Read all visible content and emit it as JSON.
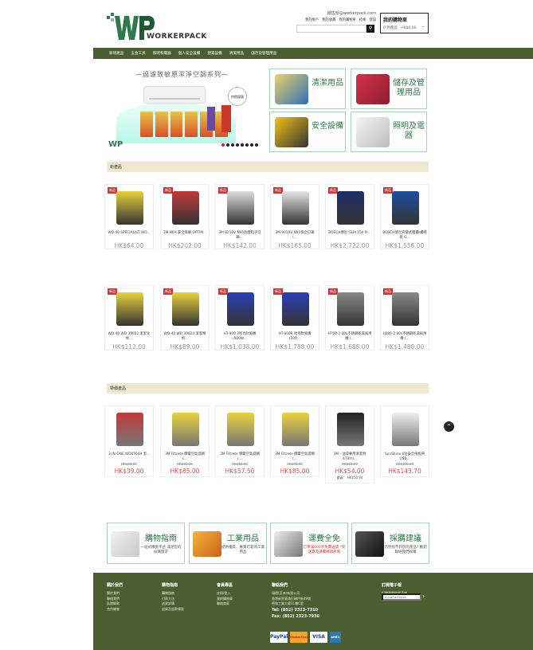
{
  "header": {
    "logo_text": "WORKERPACK",
    "email": "銷售部@workerpack.com",
    "top_links": [
      "我的帳戶",
      "我的收藏",
      "我的購物車",
      "結帳",
      "登錄"
    ],
    "search_placeholder": "",
    "search_icon": "search-icon",
    "cart_title": "我的購物車",
    "cart_value": "0 件產品 - HK$0.00"
  },
  "nav": {
    "items": [
      "新增產品",
      "五金工具",
      "照明和電器",
      "個人安全設備",
      "建築設備",
      "清潔用品",
      "儲存及管理用品"
    ]
  },
  "banner": {
    "title": "—過濾致敏原潔淨空調系列—",
    "tag": "特價優惠"
  },
  "categories": [
    {
      "label": "清潔用品",
      "icon": "cleaning-icon"
    },
    {
      "label": "儲存及管理用品",
      "icon": "storage-icon"
    },
    {
      "label": "安全設備",
      "icon": "safety-icon"
    },
    {
      "label": "照明及電器",
      "icon": "lighting-icon"
    }
  ],
  "sections": {
    "new_title": "新產品",
    "special_title": "特價產品"
  },
  "new_products": [
    {
      "name": "WD-40 SPECIALIST WD...",
      "price": "HK$64.00",
      "badge": "新品"
    },
    {
      "name": "3M H6A 安全耳罩 OPTIM...",
      "price": "HK$202.00",
      "badge": "新品"
    },
    {
      "name": "3M 8210V N95防塵粒子口罩(...",
      "price": "HK$142.00",
      "badge": "新品"
    },
    {
      "name": "3M 9010V N95保全口罩 (...",
      "price": "HK$165.00",
      "badge": "新品"
    },
    {
      "name": "BOSCH博世 GLM 150 Pr...",
      "price": "HK$2,722.00",
      "badge": "新品"
    },
    {
      "name": "BOSCH博世充電式電鑽/螺絲批 G...",
      "price": "HK$1,556.00",
      "badge": "新品"
    },
    {
      "name": "WD-40 WD 39022 潔潔化劑...",
      "price": "HK$112.00",
      "badge": "新品"
    },
    {
      "name": "WD-40 WD 39024 潔潔精劑...",
      "price": "HK$89.00",
      "badge": "新品"
    },
    {
      "name": "HT-900 3馬力吹風機 (900W...",
      "price": "HK$1,038.00",
      "badge": "新品"
    },
    {
      "name": "HT-900R 地毯吹風機 (200...",
      "price": "HK$1,788.00",
      "badge": "新品"
    },
    {
      "name": "HT60-2 60L不銹鋼乾濕兩用機 (...",
      "price": "HK$1,688.00",
      "badge": "新品"
    },
    {
      "name": "LD80-2 80L不銹鋼乾濕兩用機 (...",
      "price": "HK$1,488.00",
      "badge": "新品"
    }
  ],
  "special_products": [
    {
      "name": "3-IN-ONE WD65049 潔...",
      "old": "HK$48.00",
      "price": "HK$39.00"
    },
    {
      "name": "3M Filtrete 靜電空氣濾網 (...",
      "old": "HK$98.00",
      "price": "HK$85.00"
    },
    {
      "name": "3M Filtrete 靜電空氣濾網 (...",
      "old": "HK$68.00",
      "price": "HK$57.50"
    },
    {
      "name": "3M Filtrete 靜電空氣濾網 (...",
      "old": "HK$98.00",
      "price": "HK$85.00"
    },
    {
      "name": "3M - 油漆專用清潔劑 473ml...",
      "old": "HK$60.00",
      "price": "HK$54.00",
      "member": "會員： HK$50.00"
    },
    {
      "name": "SunShine 6位安全拖板帶USB...",
      "old": "HK$155.00",
      "price": "HK$143.70"
    }
  ],
  "services": [
    {
      "title": "購物指南",
      "desc": "一站式購買平台 滿足您的採購需求",
      "icon": "shopping-cart-icon"
    },
    {
      "title": "工業用品",
      "desc": "提供優質、專業可靠的工業用品",
      "icon": "safety-gear-icon"
    },
    {
      "title": "運費全免",
      "desc": "訂單滿400享免費送貨 *受送貨及運費條款所限",
      "icon": "delivery-truck-icon"
    },
    {
      "title": "採購建議",
      "desc": "仍然找不到您的產品? 歡迎聯絡我們採購",
      "icon": "phone-icon"
    }
  ],
  "footer": {
    "columns": [
      {
        "heading": "關於我們",
        "items": [
          "關於我們",
          "聯絡我們",
          "私隱條款",
          "合作機會"
        ]
      },
      {
        "heading": "購物指南",
        "items": [
          "購物指南",
          "付款方法",
          "送貨詳情",
          "退貨及退款條款"
        ]
      },
      {
        "heading": "會員專區",
        "items": [
          "註冊/登入",
          "我的購物車",
          "聯絡商家"
        ]
      }
    ],
    "contact_heading": "聯絡我們",
    "company": "瑞德(亞洲)有限公司",
    "address": "香港新界葵涌打磚坪街49號",
    "address2": "德和工業大廈11樓C室",
    "tel": "Tel: (852) 2323-7310",
    "fax": "Fax: (852) 2323-7930",
    "newsletter_heading": "訂閱電子報",
    "newsletter_desc": "訂閱我們的電子報",
    "newsletter_placeholder": "e-mail address",
    "payments": [
      "PayPal",
      "MasterCard",
      "VISA",
      "AMEX"
    ]
  }
}
